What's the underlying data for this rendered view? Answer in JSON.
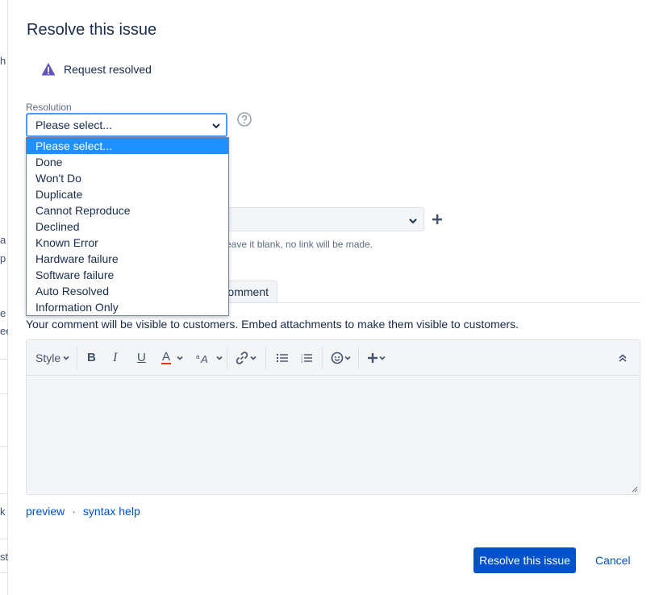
{
  "background_fragments": [
    "h",
    "a",
    "p",
    "e",
    "ee",
    "k",
    "st"
  ],
  "dialog": {
    "title": "Resolve this issue",
    "status": "Request resolved",
    "resolution": {
      "label": "Resolution",
      "selected": "Please select...",
      "options": [
        "Please select...",
        "Done",
        "Won't Do",
        "Duplicate",
        "Cannot Reproduce",
        "Declined",
        "Known Error",
        "Hardware failure",
        "Software failure",
        "Auto Resolved",
        "Information Only"
      ]
    },
    "link_hint": "eave it blank, no link will be made.",
    "tab_label": "omment",
    "comment_note": "Your comment will be visible to customers. Embed attachments to make them visible to customers.",
    "toolbar": {
      "style_label": "Style",
      "bold": "B",
      "italic": "I",
      "underline": "U",
      "text_color": "A"
    },
    "links": {
      "preview": "preview",
      "separator": "·",
      "syntax_help": "syntax help"
    },
    "buttons": {
      "resolve": "Resolve this issue",
      "cancel": "Cancel"
    }
  },
  "colors": {
    "primary": "#0052cc",
    "focus_border": "#4c9aff",
    "selected_option": "#1e90ff",
    "warning_icon": "#6554c0",
    "text_color_underline": "#de350b"
  }
}
